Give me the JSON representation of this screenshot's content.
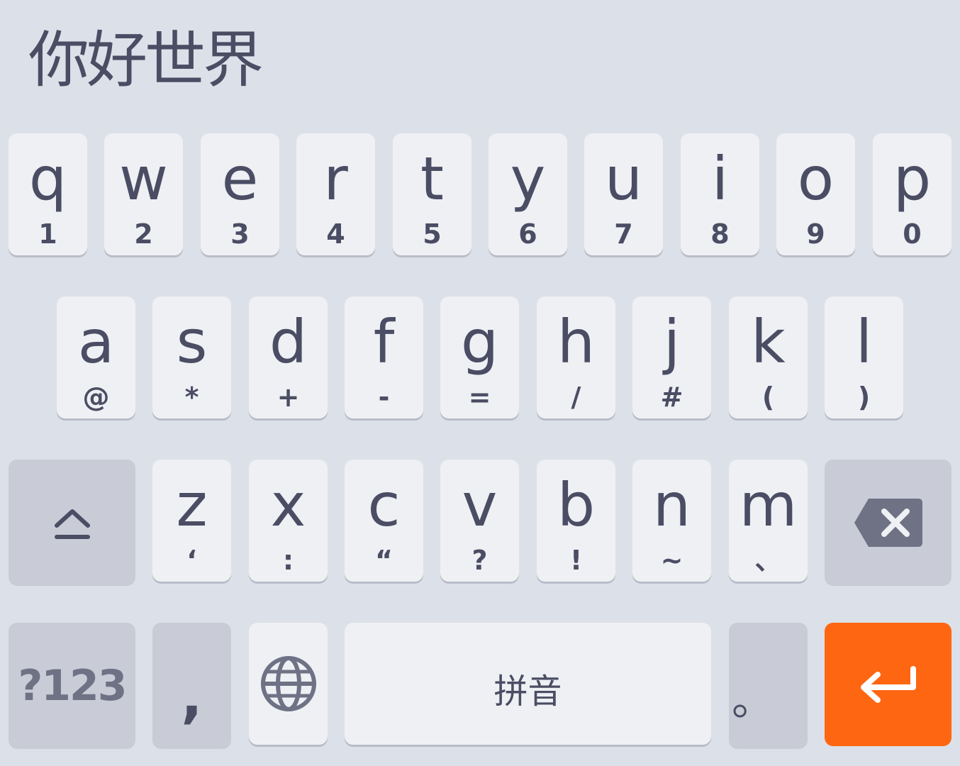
{
  "composing_text": "你好世界",
  "rows": {
    "row1": [
      {
        "main": "q",
        "sub": "1"
      },
      {
        "main": "w",
        "sub": "2"
      },
      {
        "main": "e",
        "sub": "3"
      },
      {
        "main": "r",
        "sub": "4"
      },
      {
        "main": "t",
        "sub": "5"
      },
      {
        "main": "y",
        "sub": "6"
      },
      {
        "main": "u",
        "sub": "7"
      },
      {
        "main": "i",
        "sub": "8"
      },
      {
        "main": "o",
        "sub": "9"
      },
      {
        "main": "p",
        "sub": "0"
      }
    ],
    "row2": [
      {
        "main": "a",
        "sub": "@"
      },
      {
        "main": "s",
        "sub": "*"
      },
      {
        "main": "d",
        "sub": "+"
      },
      {
        "main": "f",
        "sub": "-"
      },
      {
        "main": "g",
        "sub": "="
      },
      {
        "main": "h",
        "sub": "/"
      },
      {
        "main": "j",
        "sub": "#"
      },
      {
        "main": "k",
        "sub": "("
      },
      {
        "main": "l",
        "sub": ")"
      }
    ],
    "row3": [
      {
        "main": "z",
        "sub": "‘"
      },
      {
        "main": "x",
        "sub": ":"
      },
      {
        "main": "c",
        "sub": "“"
      },
      {
        "main": "v",
        "sub": "?"
      },
      {
        "main": "b",
        "sub": "!"
      },
      {
        "main": "n",
        "sub": "~"
      },
      {
        "main": "m",
        "sub": "、"
      }
    ]
  },
  "bottom": {
    "symbols_label": "?123",
    "comma_label": ",",
    "space_label": "拼音",
    "period_label": "。"
  },
  "icons": {
    "shift": "shift-icon",
    "backspace": "backspace-icon",
    "globe": "globe-icon",
    "enter": "enter-icon"
  },
  "colors": {
    "background": "#dce0e8",
    "key": "#eef0f4",
    "function_key": "#c9ccd7",
    "enter": "#ff6611",
    "text": "#4a4d63"
  }
}
